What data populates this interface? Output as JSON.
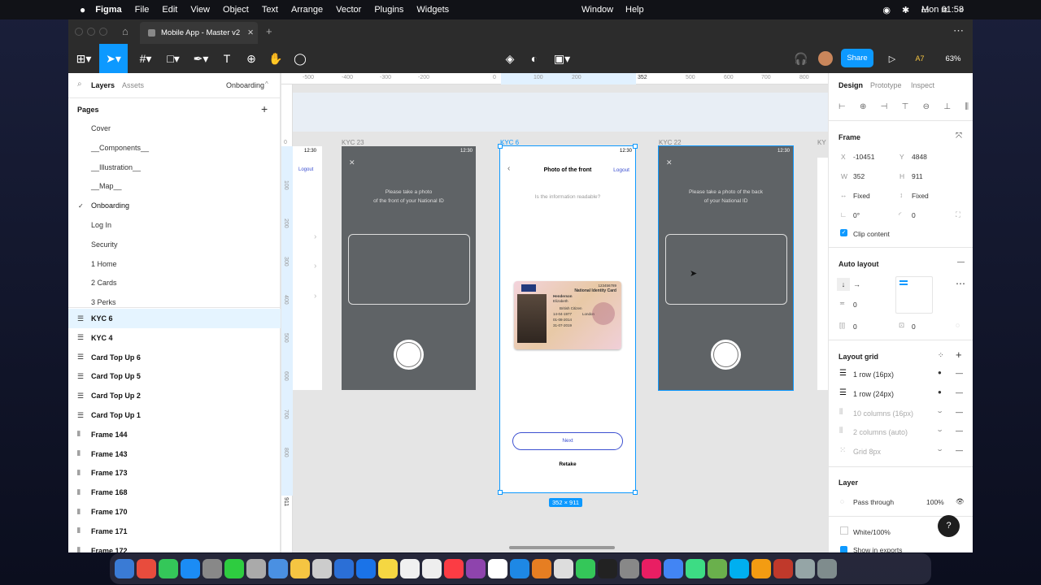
{
  "menubar": {
    "app": "Figma",
    "items": [
      "File",
      "Edit",
      "View",
      "Object",
      "Text",
      "Arrange",
      "Vector",
      "Plugins",
      "Widgets"
    ],
    "right_items": [
      "Window",
      "Help"
    ],
    "clock": "Mon 01:58"
  },
  "tab": {
    "title": "Mobile App - Master v2"
  },
  "toolbar": {
    "share": "Share",
    "zoom": "63%",
    "avatar_initials": "A7"
  },
  "left": {
    "tab_layers": "Layers",
    "tab_assets": "Assets",
    "page_selector": "Onboarding",
    "pages_header": "Pages",
    "pages": [
      "Cover",
      "__Components__",
      "__Illustration__",
      "__Map__",
      "Onboarding",
      "Log In",
      "Security",
      "1 Home",
      "2 Cards",
      "3 Perks"
    ],
    "layers": [
      {
        "label": "KYC 6",
        "type": "frame-lines"
      },
      {
        "label": "KYC 4",
        "type": "frame-lines"
      },
      {
        "label": "Card Top Up 6",
        "type": "frame-lines"
      },
      {
        "label": "Card Top Up 5",
        "type": "frame-lines"
      },
      {
        "label": "Card Top Up 2",
        "type": "frame-lines"
      },
      {
        "label": "Card Top Up 1",
        "type": "frame-lines"
      },
      {
        "label": "Frame 144",
        "type": "frame-cols"
      },
      {
        "label": "Frame 143",
        "type": "frame-cols"
      },
      {
        "label": "Frame 173",
        "type": "frame-cols"
      },
      {
        "label": "Frame 168",
        "type": "frame-cols"
      },
      {
        "label": "Frame 170",
        "type": "frame-cols"
      },
      {
        "label": "Frame 171",
        "type": "frame-cols"
      },
      {
        "label": "Frame 172",
        "type": "frame-cols"
      }
    ]
  },
  "ruler": {
    "top": [
      "-500",
      "-400",
      "-300",
      "-200",
      "0",
      "100",
      "200",
      "352",
      "500",
      "600",
      "700",
      "800"
    ],
    "left": [
      "0",
      "100",
      "200",
      "300",
      "400",
      "500",
      "600",
      "700",
      "800",
      "911"
    ]
  },
  "canvas": {
    "frames": [
      {
        "name": "KYC 23"
      },
      {
        "name": "KYC 6"
      },
      {
        "name": "KYC 22"
      },
      {
        "name": "KY"
      }
    ],
    "status_time": "12:30",
    "kyc23": {
      "text1": "Please take a photo",
      "text2": "of the front of your National ID"
    },
    "kyc6": {
      "title": "Photo of the front",
      "logout": "Logout",
      "question": "Is the information readable?",
      "next": "Next",
      "retake": "Retake",
      "size": "352 × 911",
      "card": {
        "title": "National Identity Card",
        "name1": "Henderson",
        "name2": "Elizabeth",
        "number": "123456789",
        "dob": "14-04-1977",
        "place": "London",
        "issued": "01-08-2014",
        "expiry": "31-07-2019",
        "nationality": "British Citizen"
      }
    },
    "kyc22": {
      "text1": "Please take a photo of the back",
      "text2": "of your National ID"
    },
    "partial": {
      "logout": "Logout"
    }
  },
  "right": {
    "tabs": [
      "Design",
      "Prototype",
      "Inspect"
    ],
    "frame": {
      "label": "Frame",
      "x_label": "X",
      "x": "-10451",
      "y_label": "Y",
      "y": "4848",
      "w_label": "W",
      "w": "352",
      "h_label": "H",
      "h": "911",
      "hsize": "Fixed",
      "vsize": "Fixed",
      "rotation": "0°",
      "radius": "0",
      "clip": "Clip content"
    },
    "autolayout": {
      "label": "Auto layout",
      "spacing": "0",
      "pad_h": "0",
      "pad_v": "0"
    },
    "layoutgrid": {
      "label": "Layout grid",
      "items": [
        "1 row (16px)",
        "1 row (24px)",
        "10 columns (16px)",
        "2 columns (auto)",
        "Grid 8px"
      ]
    },
    "layer": {
      "label": "Layer",
      "blend": "Pass through",
      "opacity": "100%"
    },
    "fill": {
      "value": "White/100%"
    },
    "export": {
      "label": "Show in exports"
    },
    "help": "?"
  },
  "colors": {
    "accent": "#0d99ff",
    "dark": "#2c2c2c",
    "canvas": "#e5e5e5",
    "phone_gray": "#5f6366"
  }
}
